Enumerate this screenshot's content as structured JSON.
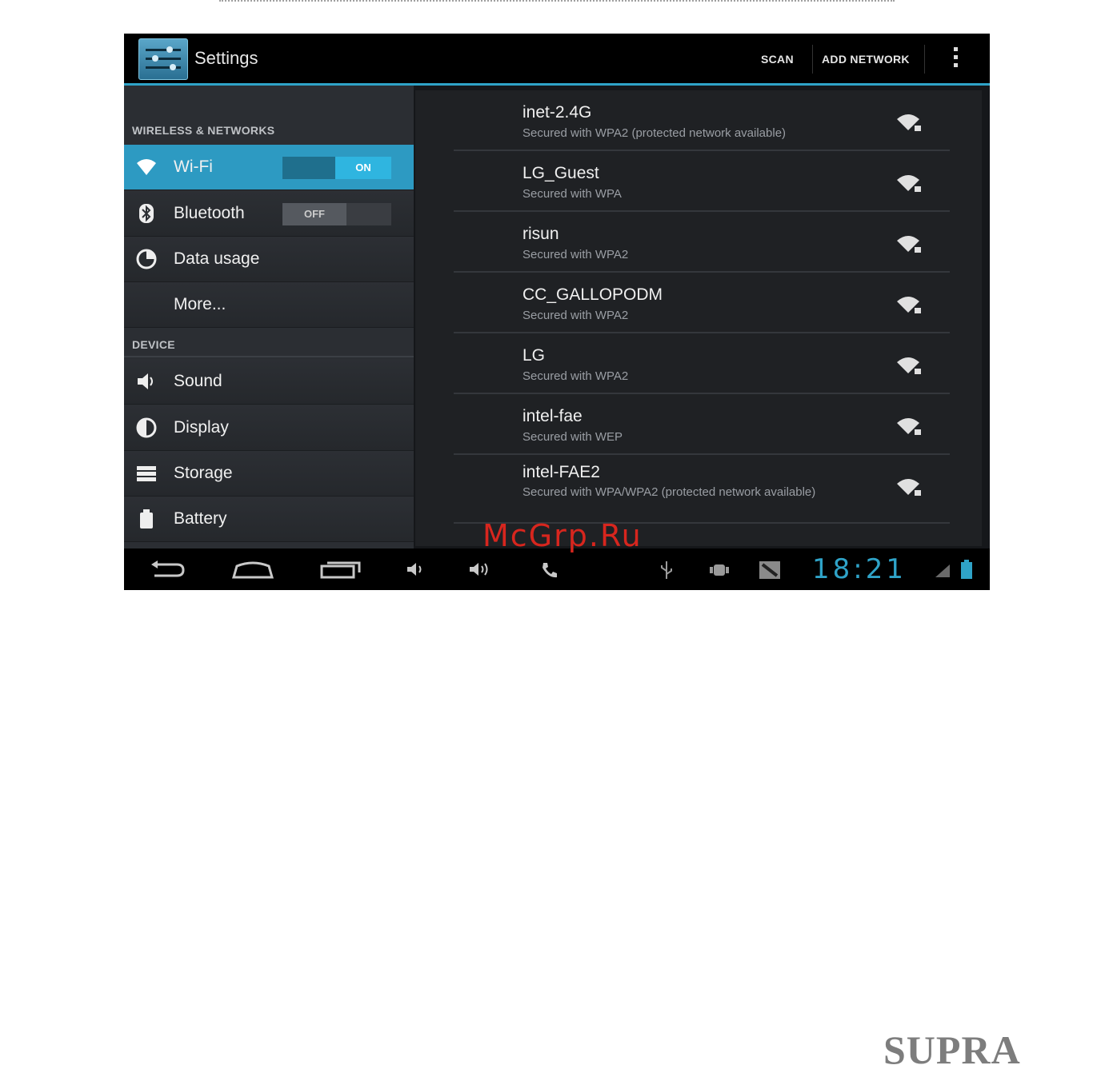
{
  "app": {
    "title": "Settings"
  },
  "actions": {
    "scan": "SCAN",
    "add_network": "ADD NETWORK"
  },
  "sidebar": {
    "section_wireless": "WIRELESS & NETWORKS",
    "section_device": "DEVICE",
    "items": [
      {
        "label": "Wi-Fi",
        "icon": "wifi-icon",
        "toggle": "ON"
      },
      {
        "label": "Bluetooth",
        "icon": "bluetooth-icon",
        "toggle": "OFF"
      },
      {
        "label": "Data usage",
        "icon": "data-usage-icon"
      },
      {
        "label": "More..."
      },
      {
        "label": "Sound",
        "icon": "speaker-icon"
      },
      {
        "label": "Display",
        "icon": "display-icon"
      },
      {
        "label": "Storage",
        "icon": "storage-icon"
      },
      {
        "label": "Battery",
        "icon": "battery-icon"
      }
    ]
  },
  "networks": [
    {
      "ssid": "inet-2.4G",
      "security": "Secured with WPA2 (protected network available)"
    },
    {
      "ssid": "LG_Guest",
      "security": "Secured with WPA"
    },
    {
      "ssid": "risun",
      "security": "Secured with WPA2"
    },
    {
      "ssid": "CC_GALLOPODM",
      "security": "Secured with WPA2"
    },
    {
      "ssid": "LG",
      "security": "Secured with WPA2"
    },
    {
      "ssid": "intel-fae",
      "security": "Secured with WEP"
    },
    {
      "ssid": "intel-FAE2",
      "security": "Secured with WPA/WPA2 (protected network available)"
    }
  ],
  "statusbar": {
    "time": "18:21"
  },
  "watermark": "McGrp.Ru",
  "brand": "SUPRA",
  "colors": {
    "accent": "#2fa3c8",
    "watermark": "#d7261e"
  }
}
